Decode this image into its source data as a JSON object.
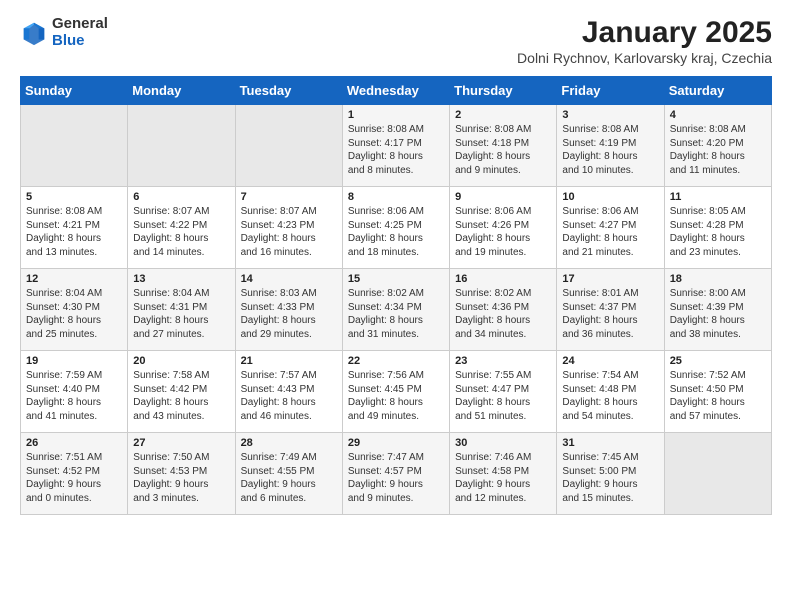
{
  "logo": {
    "general": "General",
    "blue": "Blue"
  },
  "title": "January 2025",
  "subtitle": "Dolni Rychnov, Karlovarsky kraj, Czechia",
  "weekdays": [
    "Sunday",
    "Monday",
    "Tuesday",
    "Wednesday",
    "Thursday",
    "Friday",
    "Saturday"
  ],
  "weeks": [
    [
      {
        "day": "",
        "info": "",
        "empty": true
      },
      {
        "day": "",
        "info": "",
        "empty": true
      },
      {
        "day": "",
        "info": "",
        "empty": true
      },
      {
        "day": "1",
        "info": "Sunrise: 8:08 AM\nSunset: 4:17 PM\nDaylight: 8 hours\nand 8 minutes."
      },
      {
        "day": "2",
        "info": "Sunrise: 8:08 AM\nSunset: 4:18 PM\nDaylight: 8 hours\nand 9 minutes."
      },
      {
        "day": "3",
        "info": "Sunrise: 8:08 AM\nSunset: 4:19 PM\nDaylight: 8 hours\nand 10 minutes."
      },
      {
        "day": "4",
        "info": "Sunrise: 8:08 AM\nSunset: 4:20 PM\nDaylight: 8 hours\nand 11 minutes."
      }
    ],
    [
      {
        "day": "5",
        "info": "Sunrise: 8:08 AM\nSunset: 4:21 PM\nDaylight: 8 hours\nand 13 minutes."
      },
      {
        "day": "6",
        "info": "Sunrise: 8:07 AM\nSunset: 4:22 PM\nDaylight: 8 hours\nand 14 minutes."
      },
      {
        "day": "7",
        "info": "Sunrise: 8:07 AM\nSunset: 4:23 PM\nDaylight: 8 hours\nand 16 minutes."
      },
      {
        "day": "8",
        "info": "Sunrise: 8:06 AM\nSunset: 4:25 PM\nDaylight: 8 hours\nand 18 minutes."
      },
      {
        "day": "9",
        "info": "Sunrise: 8:06 AM\nSunset: 4:26 PM\nDaylight: 8 hours\nand 19 minutes."
      },
      {
        "day": "10",
        "info": "Sunrise: 8:06 AM\nSunset: 4:27 PM\nDaylight: 8 hours\nand 21 minutes."
      },
      {
        "day": "11",
        "info": "Sunrise: 8:05 AM\nSunset: 4:28 PM\nDaylight: 8 hours\nand 23 minutes."
      }
    ],
    [
      {
        "day": "12",
        "info": "Sunrise: 8:04 AM\nSunset: 4:30 PM\nDaylight: 8 hours\nand 25 minutes."
      },
      {
        "day": "13",
        "info": "Sunrise: 8:04 AM\nSunset: 4:31 PM\nDaylight: 8 hours\nand 27 minutes."
      },
      {
        "day": "14",
        "info": "Sunrise: 8:03 AM\nSunset: 4:33 PM\nDaylight: 8 hours\nand 29 minutes."
      },
      {
        "day": "15",
        "info": "Sunrise: 8:02 AM\nSunset: 4:34 PM\nDaylight: 8 hours\nand 31 minutes."
      },
      {
        "day": "16",
        "info": "Sunrise: 8:02 AM\nSunset: 4:36 PM\nDaylight: 8 hours\nand 34 minutes."
      },
      {
        "day": "17",
        "info": "Sunrise: 8:01 AM\nSunset: 4:37 PM\nDaylight: 8 hours\nand 36 minutes."
      },
      {
        "day": "18",
        "info": "Sunrise: 8:00 AM\nSunset: 4:39 PM\nDaylight: 8 hours\nand 38 minutes."
      }
    ],
    [
      {
        "day": "19",
        "info": "Sunrise: 7:59 AM\nSunset: 4:40 PM\nDaylight: 8 hours\nand 41 minutes."
      },
      {
        "day": "20",
        "info": "Sunrise: 7:58 AM\nSunset: 4:42 PM\nDaylight: 8 hours\nand 43 minutes."
      },
      {
        "day": "21",
        "info": "Sunrise: 7:57 AM\nSunset: 4:43 PM\nDaylight: 8 hours\nand 46 minutes."
      },
      {
        "day": "22",
        "info": "Sunrise: 7:56 AM\nSunset: 4:45 PM\nDaylight: 8 hours\nand 49 minutes."
      },
      {
        "day": "23",
        "info": "Sunrise: 7:55 AM\nSunset: 4:47 PM\nDaylight: 8 hours\nand 51 minutes."
      },
      {
        "day": "24",
        "info": "Sunrise: 7:54 AM\nSunset: 4:48 PM\nDaylight: 8 hours\nand 54 minutes."
      },
      {
        "day": "25",
        "info": "Sunrise: 7:52 AM\nSunset: 4:50 PM\nDaylight: 8 hours\nand 57 minutes."
      }
    ],
    [
      {
        "day": "26",
        "info": "Sunrise: 7:51 AM\nSunset: 4:52 PM\nDaylight: 9 hours\nand 0 minutes."
      },
      {
        "day": "27",
        "info": "Sunrise: 7:50 AM\nSunset: 4:53 PM\nDaylight: 9 hours\nand 3 minutes."
      },
      {
        "day": "28",
        "info": "Sunrise: 7:49 AM\nSunset: 4:55 PM\nDaylight: 9 hours\nand 6 minutes."
      },
      {
        "day": "29",
        "info": "Sunrise: 7:47 AM\nSunset: 4:57 PM\nDaylight: 9 hours\nand 9 minutes."
      },
      {
        "day": "30",
        "info": "Sunrise: 7:46 AM\nSunset: 4:58 PM\nDaylight: 9 hours\nand 12 minutes."
      },
      {
        "day": "31",
        "info": "Sunrise: 7:45 AM\nSunset: 5:00 PM\nDaylight: 9 hours\nand 15 minutes."
      },
      {
        "day": "",
        "info": "",
        "empty": true
      }
    ]
  ]
}
